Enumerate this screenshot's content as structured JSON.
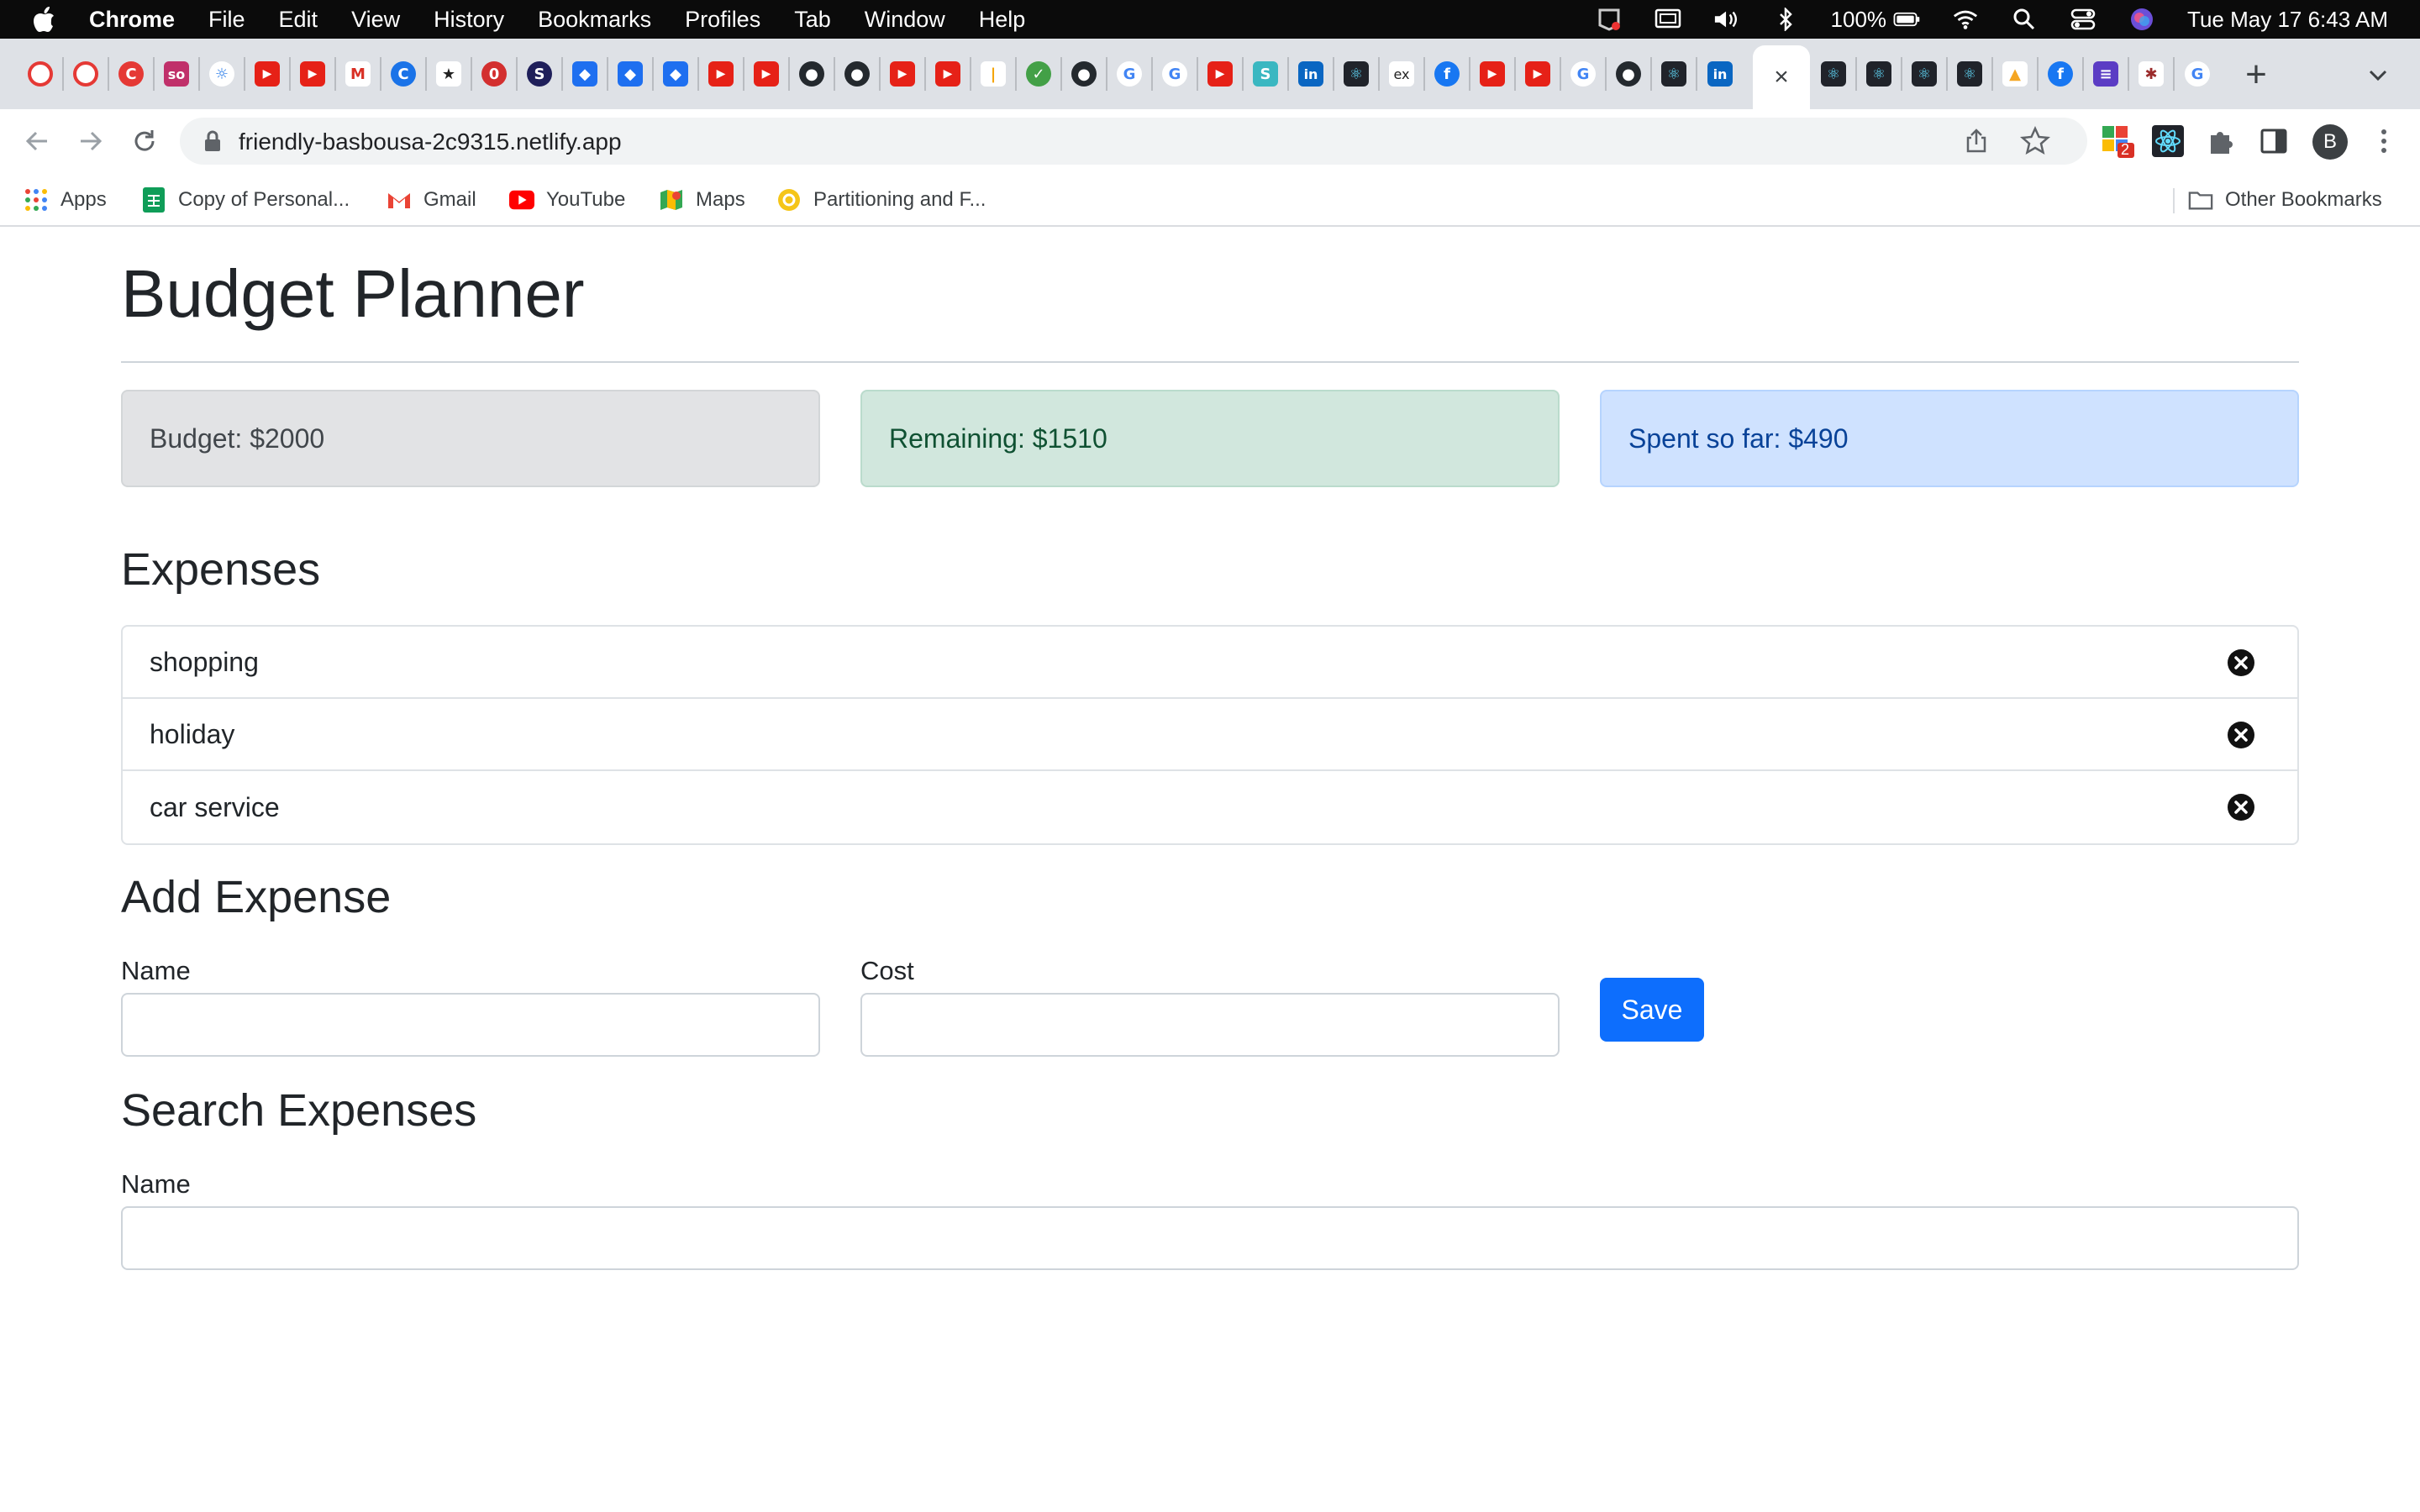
{
  "menubar": {
    "app_name": "Chrome",
    "items": [
      "File",
      "Edit",
      "View",
      "History",
      "Bookmarks",
      "Profiles",
      "Tab",
      "Window",
      "Help"
    ],
    "battery": "100%",
    "datetime": "Tue May 17  6:43 AM"
  },
  "tabs": {
    "active_close": "×",
    "new_tab": "+"
  },
  "toolbar": {
    "url": "friendly-basbousa-2c9315.netlify.app",
    "avatar_initial": "B",
    "extension_badge": "2"
  },
  "bookmarks": {
    "items": [
      "Apps",
      "Copy of Personal...",
      "Gmail",
      "YouTube",
      "Maps",
      "Partitioning and F..."
    ],
    "other": "Other Bookmarks"
  },
  "page": {
    "title": "Budget Planner",
    "budget": "Budget: $2000",
    "remaining": "Remaining: $1510",
    "spent": "Spent so far: $490",
    "expenses_heading": "Expenses",
    "expenses": [
      {
        "name": "shopping"
      },
      {
        "name": "holiday"
      },
      {
        "name": "car service"
      }
    ],
    "add_heading": "Add Expense",
    "name_label": "Name",
    "cost_label": "Cost",
    "save_label": "Save",
    "search_heading": "Search Expenses",
    "search_label": "Name"
  },
  "colors": {
    "primary": "#0d6efd",
    "budget_bg": "#e2e3e5",
    "remaining_bg": "#d1e7dd",
    "spent_bg": "#cfe2ff"
  }
}
